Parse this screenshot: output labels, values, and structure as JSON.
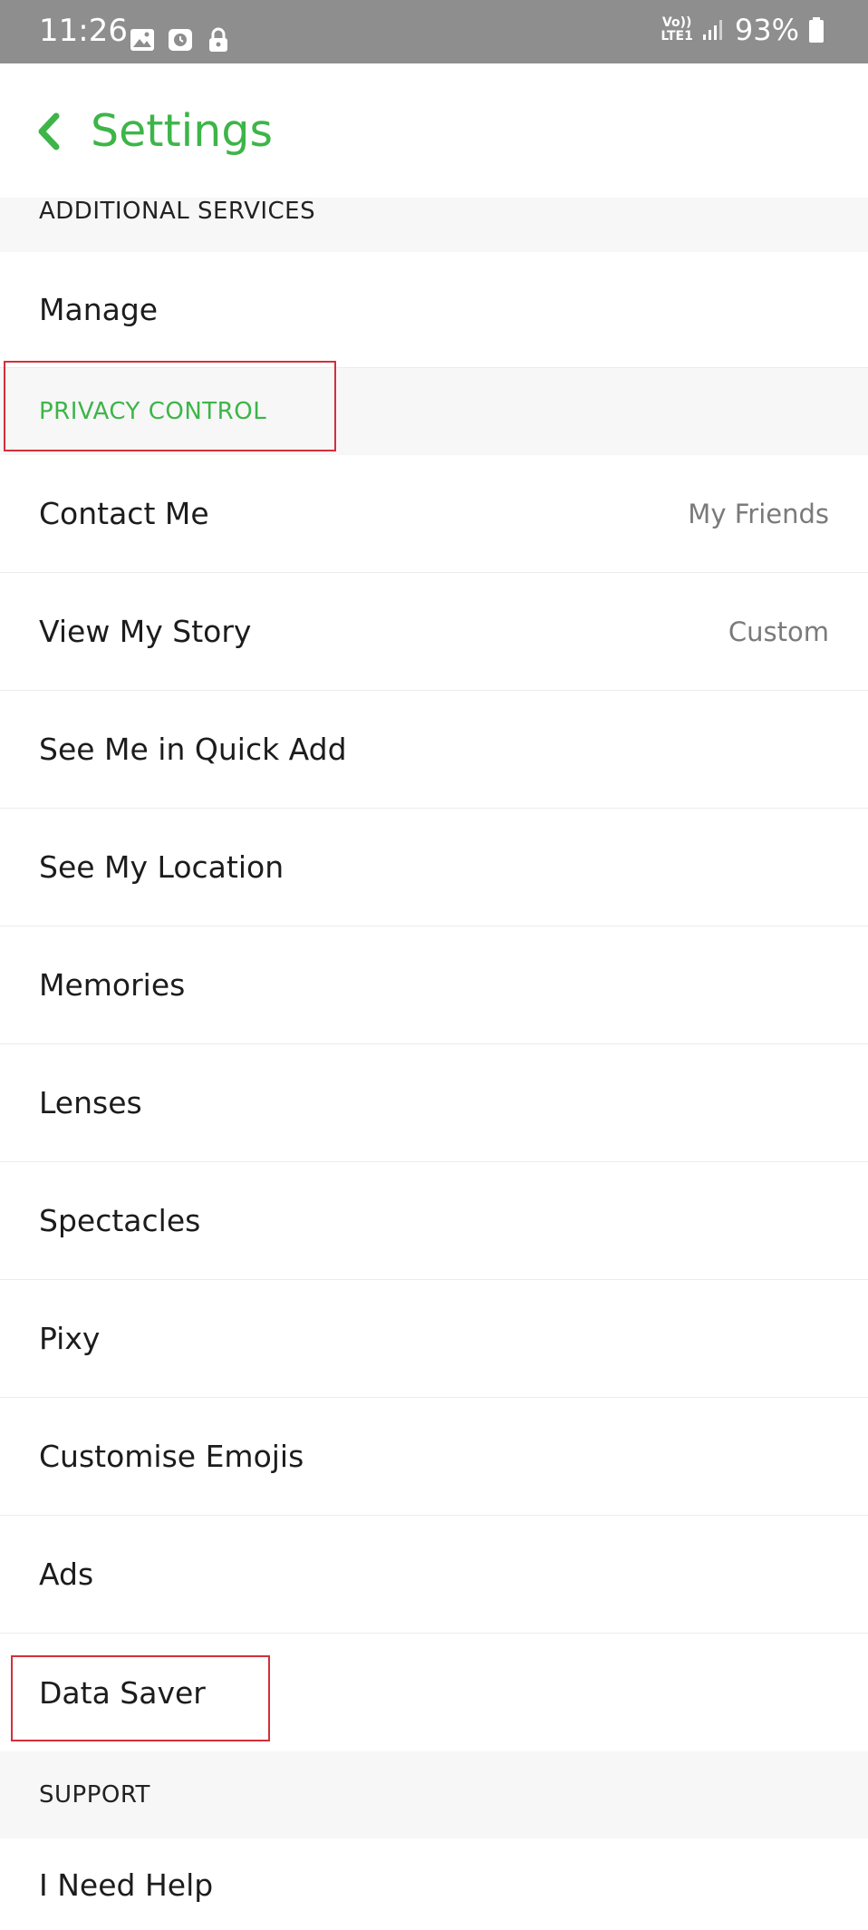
{
  "status_bar": {
    "time": "11:26",
    "network": "Vo)) LTE1",
    "battery": "93%"
  },
  "header": {
    "title": "Settings",
    "back_icon": "chevron-left-icon"
  },
  "sections": {
    "additional_services": "ADDITIONAL SERVICES",
    "privacy_control": "PRIVACY CONTROL",
    "support": "SUPPORT"
  },
  "rows": {
    "manage": "Manage",
    "contact_me": {
      "label": "Contact Me",
      "value": "My Friends"
    },
    "view_my_story": {
      "label": "View My Story",
      "value": "Custom"
    },
    "see_me_quick_add": "See Me in Quick Add",
    "see_my_location": "See My Location",
    "memories": "Memories",
    "lenses": "Lenses",
    "spectacles": "Spectacles",
    "pixy": "Pixy",
    "customise_emojis": "Customise Emojis",
    "ads": "Ads",
    "data_saver": "Data Saver",
    "i_need_help": "I Need Help"
  },
  "colors": {
    "accent_green": "#3db549",
    "status_bar": "#8e8e8e",
    "highlight_red": "#d32f3a"
  }
}
